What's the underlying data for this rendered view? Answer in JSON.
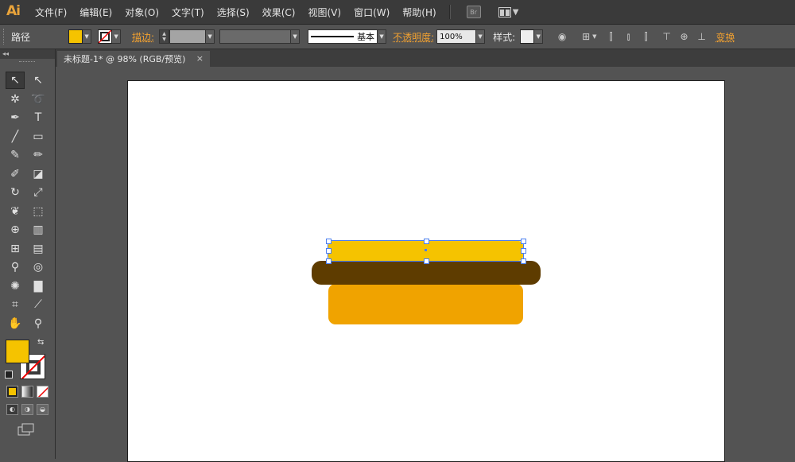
{
  "app": {
    "logo": "Ai"
  },
  "menu": [
    "文件(F)",
    "编辑(E)",
    "对象(O)",
    "文字(T)",
    "选择(S)",
    "效果(C)",
    "视图(V)",
    "窗口(W)",
    "帮助(H)"
  ],
  "menu_extra": {
    "bridge_label": "Br"
  },
  "control_bar": {
    "selection_type": "路径",
    "fill_color": "#f5c300",
    "stroke_label": "描边:",
    "stroke_profile": "基本",
    "opacity_label": "不透明度:",
    "opacity_value": "100%",
    "style_label": "样式:",
    "transform_label": "变换"
  },
  "document": {
    "tab_title": "未标题-1* @ 98% (RGB/预览)",
    "close": "×"
  },
  "toolbar": {
    "fill_color": "#f5c300",
    "tools": [
      {
        "name": "selection-tool-icon",
        "glyph": "↖"
      },
      {
        "name": "direct-selection-tool-icon",
        "glyph": "↖"
      },
      {
        "name": "magic-wand-tool-icon",
        "glyph": "✲"
      },
      {
        "name": "lasso-tool-icon",
        "glyph": "➰"
      },
      {
        "name": "pen-tool-icon",
        "glyph": "✒"
      },
      {
        "name": "type-tool-icon",
        "glyph": "T"
      },
      {
        "name": "line-tool-icon",
        "glyph": "╱"
      },
      {
        "name": "rectangle-tool-icon",
        "glyph": "▭"
      },
      {
        "name": "paintbrush-tool-icon",
        "glyph": "✎"
      },
      {
        "name": "pencil-tool-icon",
        "glyph": "✏"
      },
      {
        "name": "blob-brush-tool-icon",
        "glyph": "✐"
      },
      {
        "name": "eraser-tool-icon",
        "glyph": "◪"
      },
      {
        "name": "rotate-tool-icon",
        "glyph": "↻"
      },
      {
        "name": "scale-tool-icon",
        "glyph": "⤢"
      },
      {
        "name": "warp-tool-icon",
        "glyph": "❦"
      },
      {
        "name": "free-transform-tool-icon",
        "glyph": "⬚"
      },
      {
        "name": "shape-builder-tool-icon",
        "glyph": "⊕"
      },
      {
        "name": "perspective-grid-tool-icon",
        "glyph": "▥"
      },
      {
        "name": "mesh-tool-icon",
        "glyph": "⊞"
      },
      {
        "name": "gradient-tool-icon",
        "glyph": "▤"
      },
      {
        "name": "eyedropper-tool-icon",
        "glyph": "⚲"
      },
      {
        "name": "blend-tool-icon",
        "glyph": "◎"
      },
      {
        "name": "symbol-sprayer-tool-icon",
        "glyph": "✺"
      },
      {
        "name": "column-graph-tool-icon",
        "glyph": "▇"
      },
      {
        "name": "artboard-tool-icon",
        "glyph": "⌗"
      },
      {
        "name": "slice-tool-icon",
        "glyph": "⟋"
      },
      {
        "name": "hand-tool-icon",
        "glyph": "✋"
      },
      {
        "name": "zoom-tool-icon",
        "glyph": "⚲"
      }
    ]
  },
  "artwork": {
    "top_bar_color": "#f5c300",
    "middle_bar_color": "#5e3c00",
    "bottom_block_color": "#f0a300"
  }
}
